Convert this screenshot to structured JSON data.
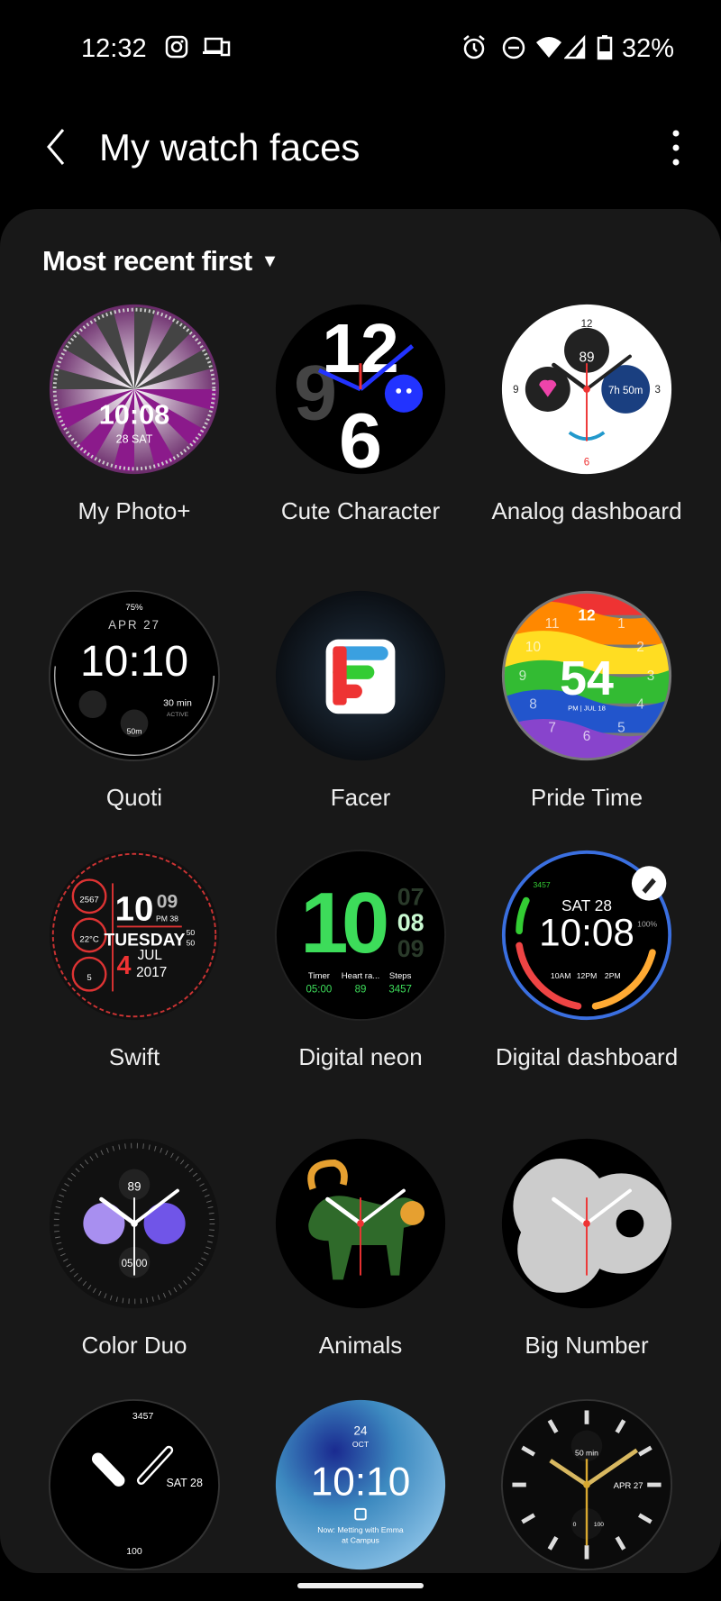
{
  "status_bar": {
    "time": "12:32",
    "battery": "32%",
    "icons": [
      "instagram-icon",
      "devices-icon",
      "alarm-icon",
      "dnd-icon",
      "wifi-icon",
      "signal-icon",
      "battery-icon"
    ]
  },
  "app_bar": {
    "title": "My watch faces",
    "back_icon": "chevron-left-icon",
    "menu_icon": "more-vertical-icon"
  },
  "sort": {
    "label": "Most recent first"
  },
  "faces": [
    {
      "label": "My Photo+",
      "texts": [
        "10:08",
        "28 SAT"
      ]
    },
    {
      "label": "Cute Character",
      "texts": [
        "12",
        "9",
        "6"
      ]
    },
    {
      "label": "Analog dashboard",
      "texts": [
        "89",
        "7h 50m",
        "12",
        "3",
        "6",
        "9"
      ]
    },
    {
      "label": "Quoti",
      "texts": [
        "75%",
        "APR 27",
        "10:10",
        "30 min",
        "ACTIVE",
        "50m"
      ]
    },
    {
      "label": "Facer",
      "texts": []
    },
    {
      "label": "Pride Time",
      "texts": [
        "12",
        "54",
        "PM | JUL 18",
        "11",
        "1",
        "10",
        "2",
        "9",
        "3",
        "8",
        "4",
        "7",
        "6",
        "5"
      ]
    },
    {
      "label": "Swift",
      "texts": [
        "10",
        "09",
        "PM 38",
        "TUESDAY",
        "4",
        "JUL",
        "2017",
        "2567",
        "22°C",
        "5",
        "50",
        "50"
      ]
    },
    {
      "label": "Digital neon",
      "texts": [
        "10",
        "07",
        "08",
        "09",
        "Timer",
        "Heart ra...",
        "Steps",
        "05:00",
        "89",
        "3457"
      ]
    },
    {
      "label": "Digital dashboard",
      "texts": [
        "SAT 28",
        "10:08",
        "10AM",
        "12PM",
        "2PM",
        "3457",
        "100%"
      ]
    },
    {
      "label": "Color Duo",
      "texts": [
        "89",
        "05:00"
      ]
    },
    {
      "label": "Animals",
      "texts": []
    },
    {
      "label": "Big Number",
      "texts": []
    },
    {
      "label": "",
      "texts": [
        "3457",
        "SAT 28",
        "100"
      ]
    },
    {
      "label": "",
      "texts": [
        "24",
        "OCT",
        "10:10",
        "Now: Metting with Emma",
        "at Campus"
      ]
    },
    {
      "label": "",
      "texts": [
        "50 min",
        "APR 27",
        "0",
        "100"
      ]
    }
  ],
  "colors": {
    "background": "#000000",
    "card": "#181818",
    "neon_green": "#3ddc5a",
    "dashboard_blue": "#3a6fe0"
  }
}
